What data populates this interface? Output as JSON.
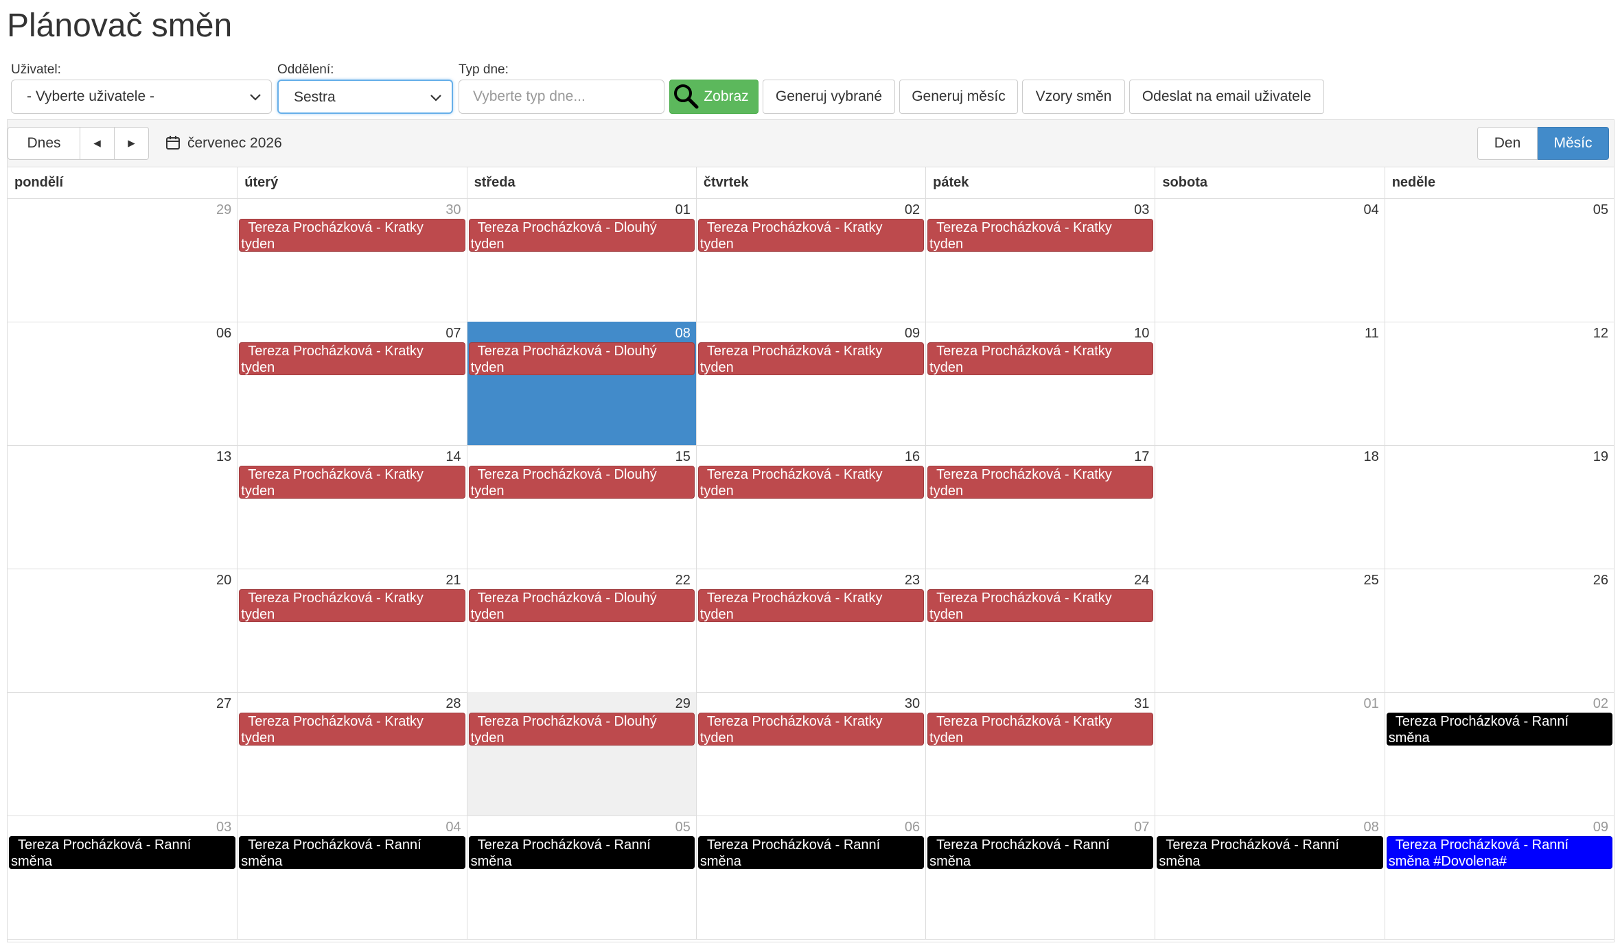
{
  "page": {
    "title": "Plánovač směn"
  },
  "filters": {
    "user_label": "Uživatel:",
    "user_value": "- Vyberte uživatele -",
    "department_label": "Oddělení:",
    "department_value": "Sestra",
    "daytype_label": "Typ dne:",
    "daytype_placeholder": "Vyberte typ dne...",
    "show_button": "Zobraz",
    "generate_selected": "Generuj vybrané",
    "generate_month": "Generuj měsíc",
    "shift_patterns": "Vzory směn",
    "send_email": "Odeslat na email uživatele"
  },
  "toolbar": {
    "today": "Dnes",
    "prev": "◂",
    "next": "▸",
    "current_period": "červenec 2026",
    "view_day": "Den",
    "view_month": "Měsíc",
    "active_view": "Měsíc"
  },
  "calendar": {
    "weekdays": [
      "pondělí",
      "úterý",
      "středa",
      "čtvrtek",
      "pátek",
      "sobota",
      "neděle"
    ],
    "weeks": [
      [
        {
          "day": "29",
          "other": true
        },
        {
          "day": "30",
          "other": true,
          "event": {
            "text1": "Tereza Procházková - Kratky",
            "text2": "tyden",
            "color": "red"
          }
        },
        {
          "day": "01",
          "event": {
            "text1": "Tereza Procházková - Dlouhý",
            "text2": "tyden",
            "color": "red"
          }
        },
        {
          "day": "02",
          "event": {
            "text1": "Tereza Procházková - Kratky",
            "text2": "tyden",
            "color": "red"
          }
        },
        {
          "day": "03",
          "event": {
            "text1": "Tereza Procházková - Kratky",
            "text2": "tyden",
            "color": "red"
          }
        },
        {
          "day": "04"
        },
        {
          "day": "05"
        }
      ],
      [
        {
          "day": "06"
        },
        {
          "day": "07",
          "event": {
            "text1": "Tereza Procházková - Kratky",
            "text2": "tyden",
            "color": "red"
          }
        },
        {
          "day": "08",
          "today": true,
          "event": {
            "text1": "Tereza Procházková - Dlouhý",
            "text2": "tyden",
            "color": "red"
          }
        },
        {
          "day": "09",
          "event": {
            "text1": "Tereza Procházková - Kratky",
            "text2": "tyden",
            "color": "red"
          }
        },
        {
          "day": "10",
          "event": {
            "text1": "Tereza Procházková - Kratky",
            "text2": "tyden",
            "color": "red"
          }
        },
        {
          "day": "11"
        },
        {
          "day": "12"
        }
      ],
      [
        {
          "day": "13"
        },
        {
          "day": "14",
          "event": {
            "text1": "Tereza Procházková - Kratky",
            "text2": "tyden",
            "color": "red"
          }
        },
        {
          "day": "15",
          "event": {
            "text1": "Tereza Procházková - Dlouhý",
            "text2": "tyden",
            "color": "red"
          }
        },
        {
          "day": "16",
          "event": {
            "text1": "Tereza Procházková - Kratky",
            "text2": "tyden",
            "color": "red"
          }
        },
        {
          "day": "17",
          "event": {
            "text1": "Tereza Procházková - Kratky",
            "text2": "tyden",
            "color": "red"
          }
        },
        {
          "day": "18"
        },
        {
          "day": "19"
        }
      ],
      [
        {
          "day": "20"
        },
        {
          "day": "21",
          "event": {
            "text1": "Tereza Procházková - Kratky",
            "text2": "tyden",
            "color": "red"
          }
        },
        {
          "day": "22",
          "event": {
            "text1": "Tereza Procházková - Dlouhý",
            "text2": "tyden",
            "color": "red"
          }
        },
        {
          "day": "23",
          "event": {
            "text1": "Tereza Procházková - Kratky",
            "text2": "tyden",
            "color": "red"
          }
        },
        {
          "day": "24",
          "event": {
            "text1": "Tereza Procházková - Kratky",
            "text2": "tyden",
            "color": "red"
          }
        },
        {
          "day": "25"
        },
        {
          "day": "26"
        }
      ],
      [
        {
          "day": "27"
        },
        {
          "day": "28",
          "event": {
            "text1": "Tereza Procházková - Kratky",
            "text2": "tyden",
            "color": "red"
          }
        },
        {
          "day": "29",
          "hover": true,
          "event": {
            "text1": "Tereza Procházková - Dlouhý",
            "text2": "tyden",
            "color": "red"
          }
        },
        {
          "day": "30",
          "event": {
            "text1": "Tereza Procházková - Kratky",
            "text2": "tyden",
            "color": "red"
          }
        },
        {
          "day": "31",
          "event": {
            "text1": "Tereza Procházková - Kratky",
            "text2": "tyden",
            "color": "red"
          }
        },
        {
          "day": "01",
          "other": true
        },
        {
          "day": "02",
          "other": true,
          "event": {
            "text1": "Tereza Procházková - Ranní",
            "text2": "směna",
            "color": "black"
          }
        }
      ],
      [
        {
          "day": "03",
          "other": true,
          "event": {
            "text1": "Tereza Procházková - Ranní",
            "text2": "směna",
            "color": "black"
          }
        },
        {
          "day": "04",
          "other": true,
          "event": {
            "text1": "Tereza Procházková - Ranní",
            "text2": "směna",
            "color": "black"
          }
        },
        {
          "day": "05",
          "other": true,
          "event": {
            "text1": "Tereza Procházková - Ranní",
            "text2": "směna",
            "color": "black"
          }
        },
        {
          "day": "06",
          "other": true,
          "event": {
            "text1": "Tereza Procházková - Ranní",
            "text2": "směna",
            "color": "black"
          }
        },
        {
          "day": "07",
          "other": true,
          "event": {
            "text1": "Tereza Procházková - Ranní",
            "text2": "směna",
            "color": "black"
          }
        },
        {
          "day": "08",
          "other": true,
          "event": {
            "text1": "Tereza Procházková - Ranní",
            "text2": "směna",
            "color": "black"
          }
        },
        {
          "day": "09",
          "other": true,
          "event": {
            "text1": "Tereza Procházková - Ranní",
            "text2": "směna #Dovolena#",
            "color": "blue"
          }
        }
      ]
    ]
  },
  "colors": {
    "event_red": "#bd4a4d",
    "event_black": "#000000",
    "event_blue": "#0000ff",
    "today_bg": "#428bca",
    "button_green": "#5cb85c"
  }
}
